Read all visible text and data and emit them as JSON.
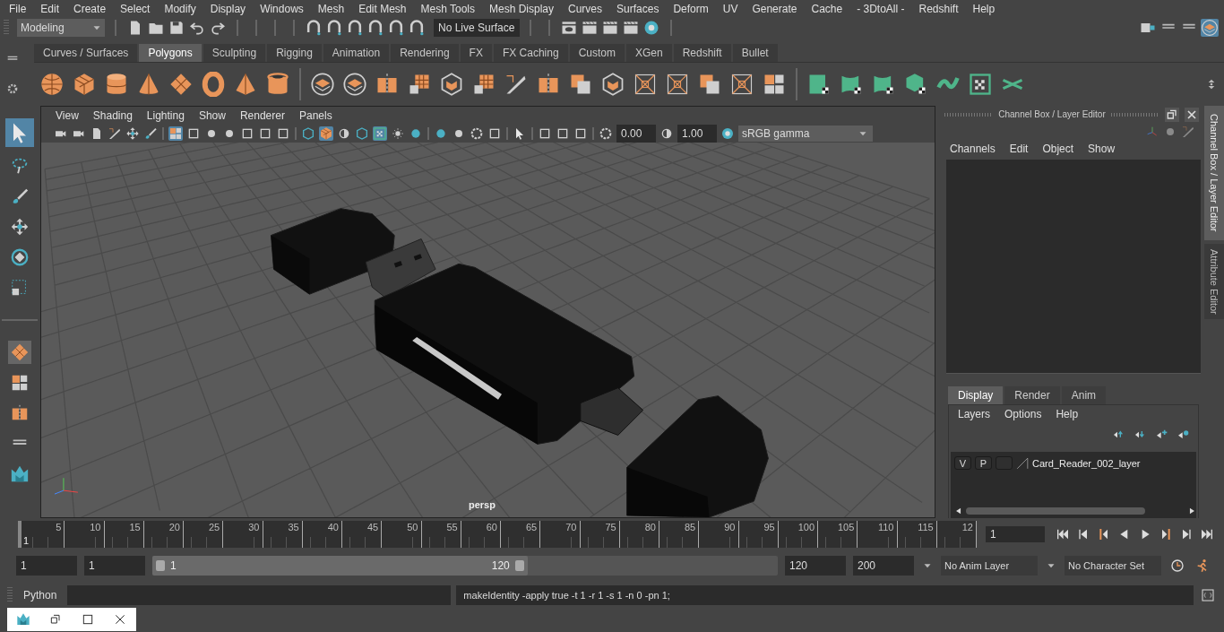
{
  "menu_bar": [
    "File",
    "Edit",
    "Create",
    "Select",
    "Modify",
    "Display",
    "Windows",
    "Mesh",
    "Edit Mesh",
    "Mesh Tools",
    "Mesh Display",
    "Curves",
    "Surfaces",
    "Deform",
    "UV",
    "Generate",
    "Cache",
    "- 3DtoAll -",
    "Redshift",
    "Help"
  ],
  "status_line": {
    "mode": "Modeling",
    "live_surface": "No Live Surface"
  },
  "shelf": {
    "tabs": [
      {
        "label": "Curves / Surfaces",
        "selected": false
      },
      {
        "label": "Polygons",
        "selected": true
      },
      {
        "label": "Sculpting",
        "selected": false
      },
      {
        "label": "Rigging",
        "selected": false
      },
      {
        "label": "Animation",
        "selected": false
      },
      {
        "label": "Rendering",
        "selected": false
      },
      {
        "label": "FX",
        "selected": false
      },
      {
        "label": "FX Caching",
        "selected": false
      },
      {
        "label": "Custom",
        "selected": false
      },
      {
        "label": "XGen",
        "selected": false
      },
      {
        "label": "Redshift",
        "selected": false
      },
      {
        "label": "Bullet",
        "selected": false
      }
    ]
  },
  "viewport": {
    "menus": [
      "View",
      "Shading",
      "Lighting",
      "Show",
      "Renderer",
      "Panels"
    ],
    "exposure": "0.00",
    "gamma": "1.00",
    "color_space": "sRGB gamma",
    "camera_label": "persp"
  },
  "channel_box": {
    "title": "Channel Box / Layer Editor",
    "menus": [
      "Channels",
      "Edit",
      "Object",
      "Show"
    ]
  },
  "layer_editor": {
    "tabs": [
      {
        "label": "Display",
        "selected": true
      },
      {
        "label": "Render",
        "selected": false
      },
      {
        "label": "Anim",
        "selected": false
      }
    ],
    "menus": [
      "Layers",
      "Options",
      "Help"
    ],
    "layers": [
      {
        "visibility": "V",
        "playback": "P",
        "name": "Card_Reader_002_layer"
      }
    ]
  },
  "side_tabs": [
    {
      "label": "Channel Box / Layer Editor",
      "selected": true
    },
    {
      "label": "Attribute Editor",
      "selected": false
    }
  ],
  "time_slider": {
    "ticks": [
      "5",
      "10",
      "15",
      "20",
      "25",
      "30",
      "35",
      "40",
      "45",
      "50",
      "55",
      "60",
      "65",
      "70",
      "75",
      "80",
      "85",
      "90",
      "95",
      "100",
      "105",
      "110",
      "115",
      "12"
    ],
    "start_label": "1",
    "current_frame": "1"
  },
  "range_slider": {
    "level": 0.6,
    "start": "1",
    "playback_start": "1",
    "range_start": "1",
    "range_end": "120",
    "playback_end": "120",
    "end": "200",
    "anim_layer": "No Anim Layer",
    "character_set": "No Character Set"
  },
  "command_line": {
    "language": "Python",
    "result": "makeIdentity -apply true -t 1 -r 1 -s 1 -n 0 -pn 1;"
  }
}
